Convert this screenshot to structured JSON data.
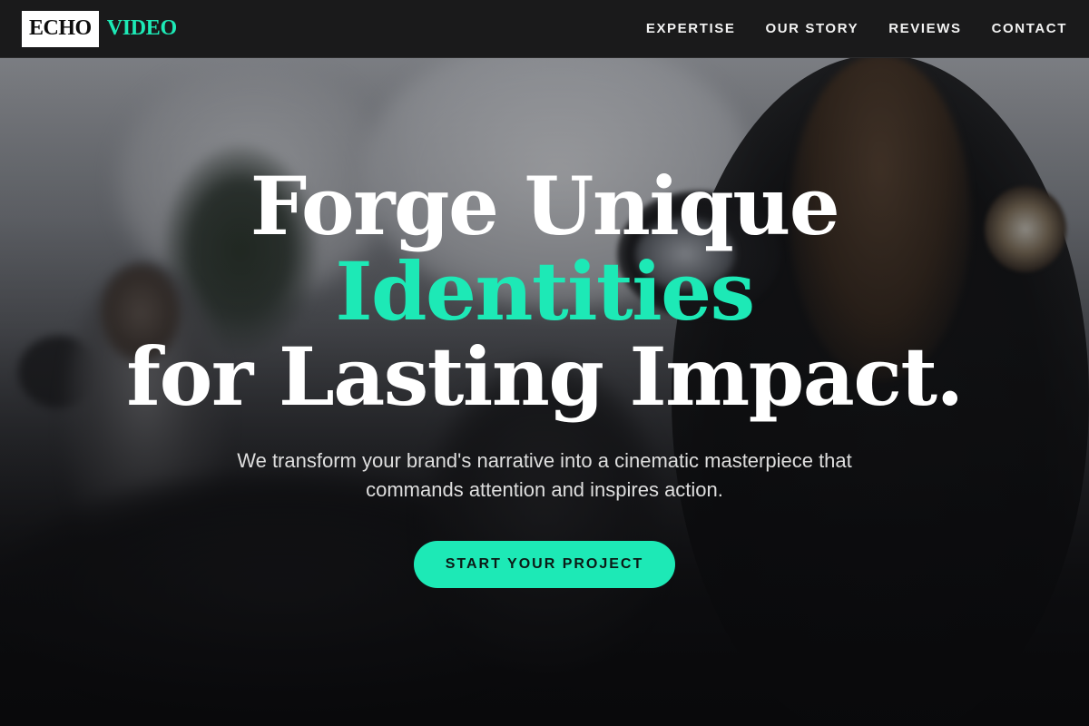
{
  "brand": {
    "logo_box_text": "ECHO",
    "logo_accent_text": "VIDEO",
    "accent_color": "#1de9b6"
  },
  "nav": {
    "items": [
      {
        "label": "EXPERTISE"
      },
      {
        "label": "OUR STORY"
      },
      {
        "label": "REVIEWS"
      },
      {
        "label": "CONTACT"
      }
    ]
  },
  "hero": {
    "headline_line1": "Forge Unique",
    "headline_line2": "Identities",
    "headline_line3": "for Lasting Impact.",
    "subtext": "We transform your brand's narrative into a cinematic masterpiece that commands attention and inspires action.",
    "cta_label": "START YOUR PROJECT",
    "background_image": "blurred photo of a video crew filming an interview"
  }
}
